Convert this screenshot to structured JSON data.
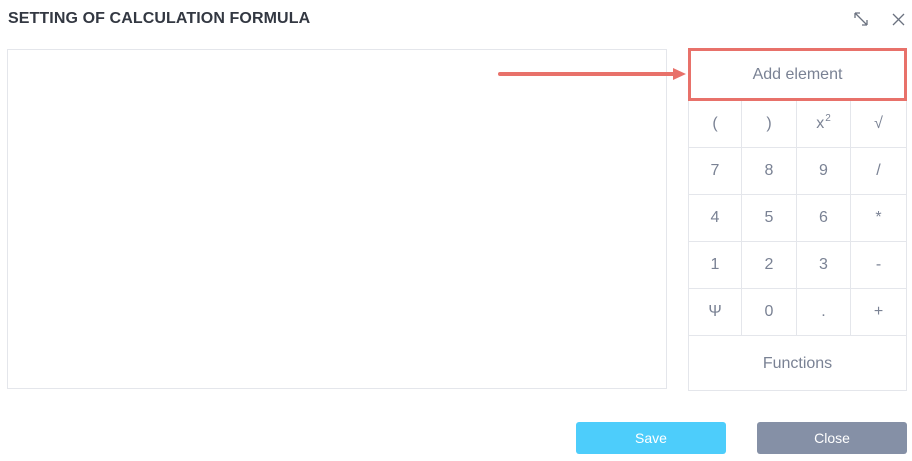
{
  "dialog": {
    "title": "SETTING OF CALCULATION FORMULA"
  },
  "formula_pad": {
    "add_element_label": "Add element",
    "keys": [
      "(",
      ")",
      "x",
      "√",
      "7",
      "8",
      "9",
      "/",
      "4",
      "5",
      "6",
      "*",
      "1",
      "2",
      "3",
      "-",
      "Ψ",
      "0",
      ".",
      "+"
    ],
    "square_superscript": "2",
    "functions_label": "Functions"
  },
  "footer": {
    "save_label": "Save",
    "close_label": "Close"
  },
  "colors": {
    "highlight": "#e8716a",
    "save_button": "#4dcdfb",
    "close_button": "#8590a6"
  },
  "icons": [
    "expand-icon",
    "close-icon",
    "arrow-right-icon"
  ]
}
